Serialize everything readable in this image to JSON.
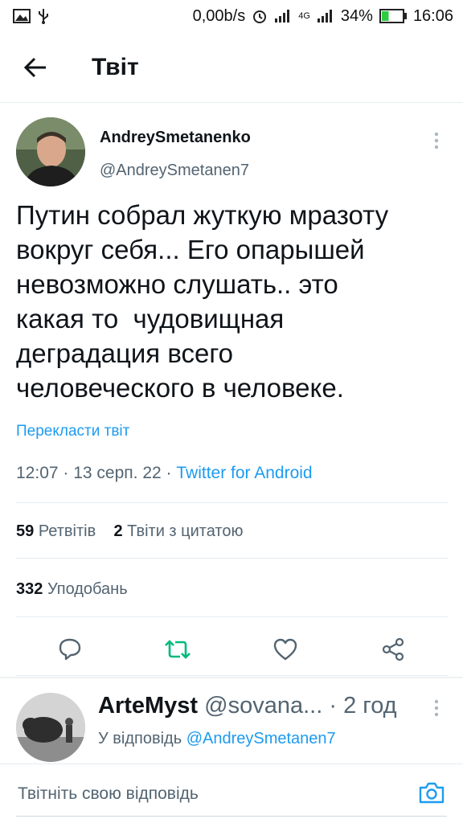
{
  "status_bar": {
    "net_speed": "0,00b/s",
    "network": "4G",
    "battery": "34%",
    "time": "16:06",
    "battery_level": 0.34
  },
  "header": {
    "title": "Твіт"
  },
  "tweet": {
    "author_name": "AndreySmetanenko",
    "author_handle": "@AndreySmetanen7",
    "text": "Путин собрал жуткую мразоту\nвокруг себя... Его опарышей\nневозможно слушать.. это\nкакая то  чудовищная\nдеградация всего\nчеловеческого в человеке.",
    "translate_label": "Перекласти твіт",
    "time": "12:07",
    "date": "13 серп. 22",
    "source": "Twitter for Android",
    "retweets_count": "59",
    "retweets_label": "Ретвітів",
    "quotes_count": "2",
    "quotes_label": "Твіти з цитатою",
    "likes_count": "332",
    "likes_label": "Уподобань"
  },
  "reply": {
    "name": "ArteMyst",
    "handle": "@sovana...",
    "time": "2 год",
    "reply_prefix": "У відповідь",
    "reply_mention": "@AndreySmetanen7"
  },
  "composer": {
    "placeholder": "Твітніть свою відповідь"
  },
  "colors": {
    "accent": "#1d9bf0",
    "retweet": "#00ba7c",
    "battery": "#2ecc40"
  }
}
